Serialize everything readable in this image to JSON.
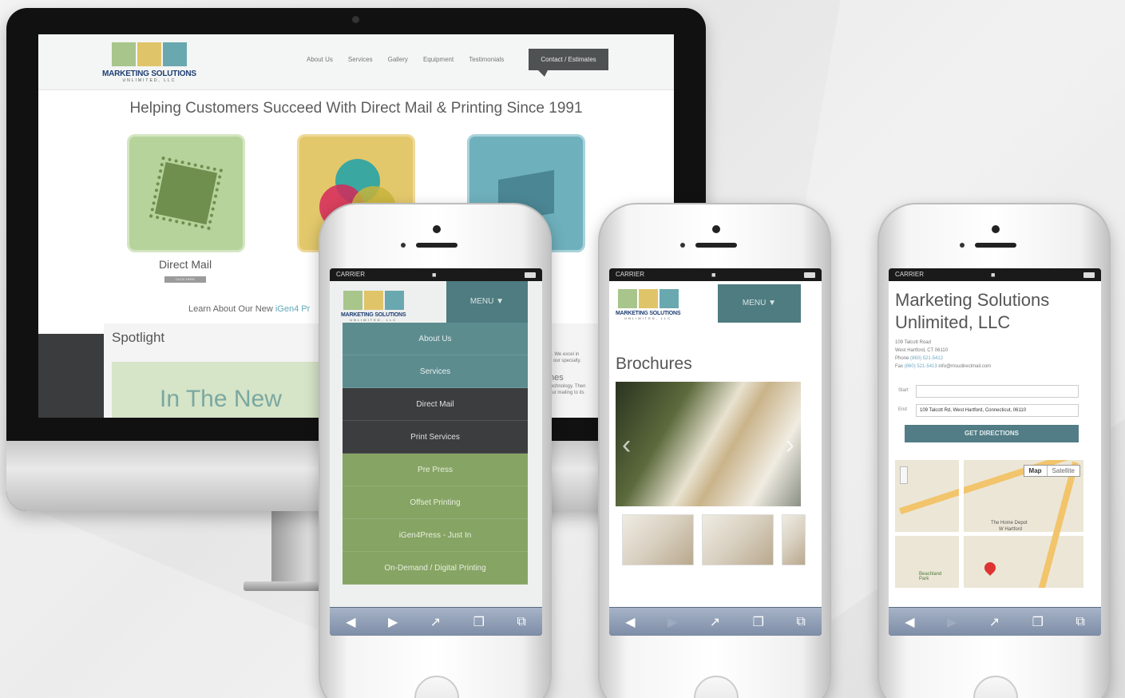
{
  "desktop": {
    "logo": {
      "name": "MARKETING SOLUTIONS",
      "sub": "UNLIMITED, LLC"
    },
    "nav": [
      "About Us",
      "Services",
      "Gallery",
      "Equipment",
      "Testimonials"
    ],
    "contact": "Contact / Estimates",
    "heading": "Helping Customers Succeed With Direct Mail & Printing Since 1991",
    "service_label": "Direct Mail",
    "service_button": "CLICK HERE",
    "learn_text": "Learn About Our New",
    "learn_link": "iGen4 Pr",
    "spotlight": "Spotlight",
    "news_text": "In The New",
    "right_text_1": "s. We excel in",
    "right_text_2": "e our specialty.",
    "right_heading": "nes",
    "right_text_3": "technology. Then",
    "right_text_4": "our mailing to its"
  },
  "phone1": {
    "carrier": "CARRIER",
    "logo": {
      "name": "MARKETING SOLUTIONS",
      "sub": "UNLIMITED, LLC"
    },
    "menu": "MENU",
    "items": [
      "About Us",
      "Services",
      "Direct Mail",
      "Print Services",
      "Pre Press",
      "Offset Printing",
      "iGen4Press - Just In",
      "On-Demand / Digital Printing"
    ]
  },
  "phone2": {
    "carrier": "CARRIER",
    "logo": {
      "name": "MARKETING SOLUTIONS",
      "sub": "UNLIMITED, LLC"
    },
    "menu": "MENU",
    "title": "Brochures"
  },
  "phone3": {
    "carrier": "CARRIER",
    "title_line1": "Marketing Solutions",
    "title_line2": "Unlimited, LLC",
    "address1": "109 Talcott Road",
    "address2": "West Hartford, CT 06110",
    "phone_label": "Phone",
    "phone_value": "(860) 521-5412",
    "fax_label": "Fax",
    "fax_value": "(860) 521-5413",
    "email": "info@msudirectmail.com",
    "start_label": "Start",
    "end_label": "End",
    "end_value": "109 Talcott Rd, West Hartford, Connecticut, 06110",
    "get_directions": "GET DIRECTIONS",
    "map_tab_map": "Map",
    "map_tab_satellite": "Satellite",
    "map_place": "The Home Depot",
    "map_place_sub": "W Hartford",
    "map_park": "Beachland Park"
  },
  "toolbar_icons": [
    "back-arrow-icon",
    "forward-arrow-icon",
    "share-icon",
    "bookmarks-icon",
    "tabs-icon"
  ]
}
